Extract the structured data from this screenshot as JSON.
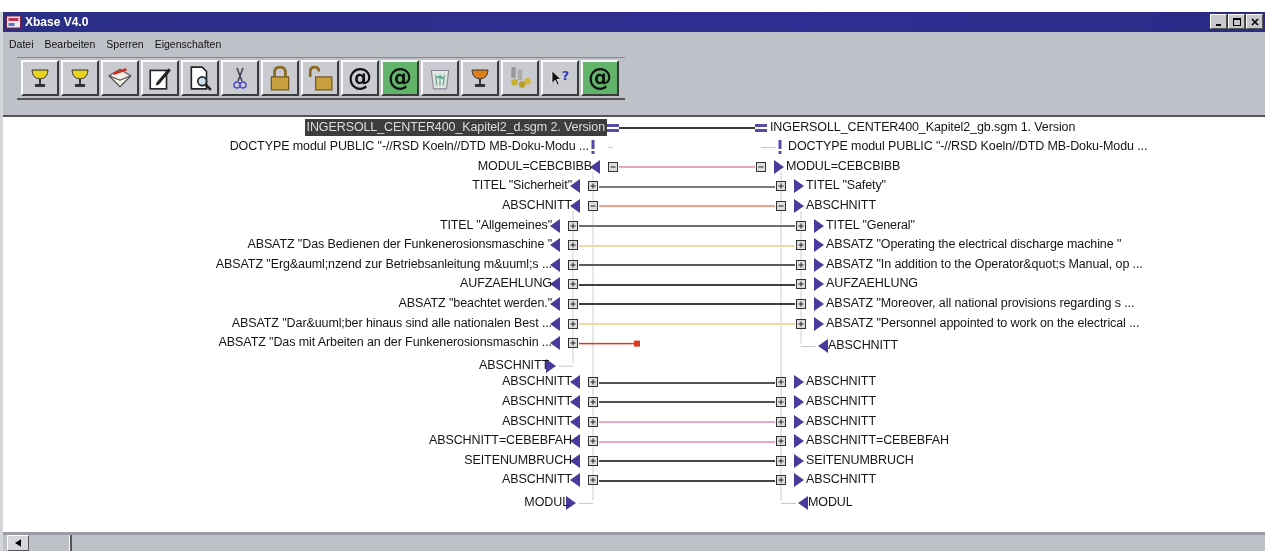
{
  "window": {
    "title": "Xbase V4.0"
  },
  "menu": [
    "Datei",
    "Bearbeiten",
    "Sperren",
    "Eigenschaften"
  ],
  "toolbar": [
    {
      "kind": "cup",
      "color": "#e8d21c"
    },
    {
      "kind": "cup",
      "color": "#e8d21c"
    },
    {
      "kind": "mail"
    },
    {
      "kind": "edit"
    },
    {
      "kind": "preview"
    },
    {
      "kind": "cut"
    },
    {
      "kind": "lock"
    },
    {
      "kind": "unlock"
    },
    {
      "kind": "glyph",
      "glyph": "@",
      "highlighted": false
    },
    {
      "kind": "glyph",
      "glyph": "@",
      "highlighted": true
    },
    {
      "kind": "bin"
    },
    {
      "kind": "cup",
      "color": "#e0801c"
    },
    {
      "kind": "people"
    },
    {
      "kind": "help",
      "glyph": "?"
    },
    {
      "kind": "glyph",
      "glyph": "@",
      "highlighted": true
    }
  ],
  "left_tree": {
    "kind": "document",
    "label": "INGERSOLL_CENTER400_Kapitel2_d.sgm 2. Version",
    "selected": true,
    "link": {
      "kind": "pair",
      "color": "#3a3a3a"
    },
    "children": [
      {
        "kind": "doctype",
        "label": "DOCTYPE modul PUBLIC \"-//RSD Koeln//DTD MB-Doku-Modu ..."
      },
      {
        "kind": "element",
        "label": "MODUL=CEBCBIBB",
        "expanded": true,
        "link": {
          "kind": "pair",
          "color": "#e6a6c0"
        },
        "end_label": "MODUL",
        "children": [
          {
            "kind": "element",
            "label": "TITEL \"Sicherheit\"",
            "expanded": false,
            "link": {
              "kind": "pair",
              "color": "#7a7a7a"
            }
          },
          {
            "kind": "element",
            "label": "ABSCHNITT",
            "expanded": true,
            "link": {
              "kind": "pair",
              "color": "#f0a08c"
            },
            "end_label": "ABSCHNITT",
            "children": [
              {
                "kind": "element",
                "label": "TITEL \"Allgemeines\"",
                "expanded": false,
                "link": {
                  "kind": "pair",
                  "color": "#6e6e6e"
                }
              },
              {
                "kind": "element",
                "label": "ABSATZ \"Das Bedienen der Funkenerosionsmaschine \"",
                "expanded": false,
                "link": {
                  "kind": "pair",
                  "color": "#f2d9a4"
                }
              },
              {
                "kind": "element",
                "label": "ABSATZ \"Erg&auml;nzend zur Betriebsanleitung m&uuml;s ...",
                "expanded": false,
                "link": {
                  "kind": "pair",
                  "color": "#5a5a5a"
                }
              },
              {
                "kind": "element",
                "label": "AUFZAEHLUNG",
                "expanded": false,
                "link": {
                  "kind": "pair",
                  "color": "#3e3e3e"
                }
              },
              {
                "kind": "element",
                "label": "ABSATZ \"beachtet werden.\"",
                "expanded": false,
                "link": {
                  "kind": "pair",
                  "color": "#3e3e3e"
                }
              },
              {
                "kind": "element",
                "label": "ABSATZ \"Dar&uuml;ber hinaus sind alle nationalen Best ...",
                "expanded": false,
                "link": {
                  "kind": "pair",
                  "color": "#f2d9a4"
                }
              },
              {
                "kind": "element",
                "label": "ABSATZ \"Das mit Arbeiten an der Funkenerosionsmaschin ...",
                "expanded": false,
                "link": {
                  "kind": "unmatched",
                  "color": "#e03a1c"
                }
              }
            ]
          },
          {
            "kind": "element",
            "label": "ABSCHNITT",
            "expanded": false,
            "link": {
              "kind": "pair",
              "color": "#5a5050"
            }
          },
          {
            "kind": "element",
            "label": "ABSCHNITT",
            "expanded": false,
            "link": {
              "kind": "pair",
              "color": "#5a5050"
            }
          },
          {
            "kind": "element",
            "label": "ABSCHNITT",
            "expanded": false,
            "link": {
              "kind": "pair",
              "color": "#e8a8c4"
            }
          },
          {
            "kind": "element",
            "label": "ABSCHNITT=CEBEBFAH",
            "expanded": false,
            "link": {
              "kind": "pair",
              "color": "#e8a8c4"
            }
          },
          {
            "kind": "element",
            "label": "SEITENUMBRUCH",
            "expanded": false,
            "link": {
              "kind": "pair",
              "color": "#4a4444"
            }
          },
          {
            "kind": "element",
            "label": "ABSCHNITT",
            "expanded": false,
            "link": {
              "kind": "pair",
              "color": "#4a4444"
            }
          }
        ]
      }
    ]
  },
  "right_tree": {
    "kind": "document",
    "label": "INGERSOLL_CENTER400_Kapitel2_gb.sgm 1. Version",
    "selected": false,
    "children": [
      {
        "kind": "doctype",
        "label": "DOCTYPE modul PUBLIC \"-//RSD Koeln//DTD MB-Doku-Modu ..."
      },
      {
        "kind": "element",
        "label": "MODUL=CEBCBIBB",
        "expanded": true,
        "end_label": "MODUL",
        "children": [
          {
            "kind": "element",
            "label": "TITEL \"Safety\"",
            "expanded": false
          },
          {
            "kind": "element",
            "label": "ABSCHNITT",
            "expanded": true,
            "end_label": "ABSCHNITT",
            "children": [
              {
                "kind": "element",
                "label": "TITEL \"General\"",
                "expanded": false
              },
              {
                "kind": "element",
                "label": "ABSATZ \"Operating the electrical discharge machine \"",
                "expanded": false
              },
              {
                "kind": "element",
                "label": "ABSATZ \"In addition to the Operator&quot;s Manual, op ...",
                "expanded": false
              },
              {
                "kind": "element",
                "label": "AUFZAEHLUNG",
                "expanded": false
              },
              {
                "kind": "element",
                "label": "ABSATZ \"Moreover, all national provisions regarding s ...",
                "expanded": false
              },
              {
                "kind": "element",
                "label": "ABSATZ \"Personnel appointed to work on the electrical ...",
                "expanded": false
              }
            ]
          },
          {
            "kind": "element",
            "label": "ABSCHNITT",
            "expanded": false
          },
          {
            "kind": "element",
            "label": "ABSCHNITT",
            "expanded": false
          },
          {
            "kind": "element",
            "label": "ABSCHNITT",
            "expanded": false
          },
          {
            "kind": "element",
            "label": "ABSCHNITT=CEBEBFAH",
            "expanded": false
          },
          {
            "kind": "element",
            "label": "SEITENUMBRUCH",
            "expanded": false
          },
          {
            "kind": "element",
            "label": "ABSCHNITT",
            "expanded": false
          }
        ]
      }
    ]
  }
}
